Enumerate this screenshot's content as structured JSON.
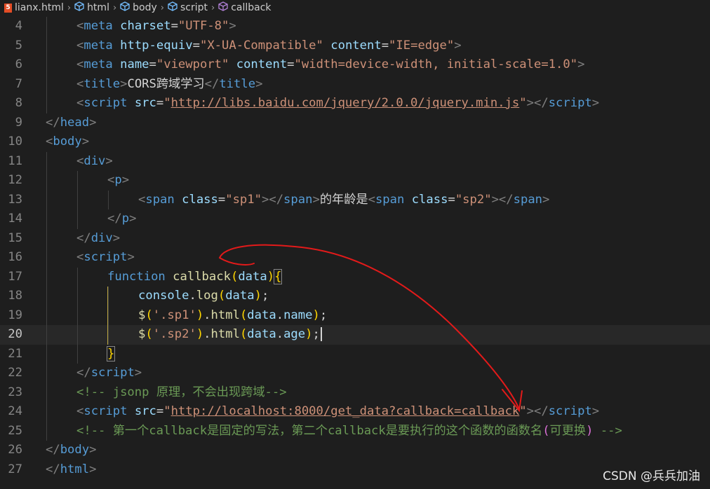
{
  "breadcrumb": [
    {
      "label": "lianx.html",
      "icon": "html-file-icon"
    },
    {
      "label": "html",
      "icon": "element-cube-icon"
    },
    {
      "label": "body",
      "icon": "element-cube-icon"
    },
    {
      "label": "script",
      "icon": "element-cube-icon"
    },
    {
      "label": "callback",
      "icon": "function-cube-icon"
    }
  ],
  "lines": [
    {
      "n": "4",
      "indent": 1,
      "tokens": [
        [
          "t",
          "<"
        ],
        [
          "tag",
          "meta"
        ],
        [
          "txt",
          " "
        ],
        [
          "attr",
          "charset"
        ],
        [
          "txt",
          "="
        ],
        [
          "str",
          "\"UTF-8\""
        ],
        [
          "t",
          ">"
        ]
      ]
    },
    {
      "n": "5",
      "indent": 1,
      "tokens": [
        [
          "t",
          "<"
        ],
        [
          "tag",
          "meta"
        ],
        [
          "txt",
          " "
        ],
        [
          "attr",
          "http-equiv"
        ],
        [
          "txt",
          "="
        ],
        [
          "str",
          "\"X-UA-Compatible\""
        ],
        [
          "txt",
          " "
        ],
        [
          "attr",
          "content"
        ],
        [
          "txt",
          "="
        ],
        [
          "str",
          "\"IE=edge\""
        ],
        [
          "t",
          ">"
        ]
      ]
    },
    {
      "n": "6",
      "indent": 1,
      "tokens": [
        [
          "t",
          "<"
        ],
        [
          "tag",
          "meta"
        ],
        [
          "txt",
          " "
        ],
        [
          "attr",
          "name"
        ],
        [
          "txt",
          "="
        ],
        [
          "str",
          "\"viewport\""
        ],
        [
          "txt",
          " "
        ],
        [
          "attr",
          "content"
        ],
        [
          "txt",
          "="
        ],
        [
          "str",
          "\"width=device-width, initial-scale=1.0\""
        ],
        [
          "t",
          ">"
        ]
      ]
    },
    {
      "n": "7",
      "indent": 1,
      "tokens": [
        [
          "t",
          "<"
        ],
        [
          "tag",
          "title"
        ],
        [
          "t",
          ">"
        ],
        [
          "txt",
          "CORS跨域学习"
        ],
        [
          "t",
          "</"
        ],
        [
          "tag",
          "title"
        ],
        [
          "t",
          ">"
        ]
      ]
    },
    {
      "n": "8",
      "indent": 1,
      "tokens": [
        [
          "t",
          "<"
        ],
        [
          "tag",
          "script"
        ],
        [
          "txt",
          " "
        ],
        [
          "attr",
          "src"
        ],
        [
          "txt",
          "="
        ],
        [
          "str",
          "\""
        ],
        [
          "str url",
          "http://libs.baidu.com/jquery/2.0.0/jquery.min.js"
        ],
        [
          "str",
          "\""
        ],
        [
          "t",
          ">"
        ],
        [
          "t",
          "</"
        ],
        [
          "tag",
          "script"
        ],
        [
          "t",
          ">"
        ]
      ]
    },
    {
      "n": "9",
      "indent": 0,
      "tokens": [
        [
          "t",
          "</"
        ],
        [
          "tag",
          "head"
        ],
        [
          "t",
          ">"
        ]
      ]
    },
    {
      "n": "10",
      "indent": 0,
      "tokens": [
        [
          "t",
          "<"
        ],
        [
          "tag",
          "body"
        ],
        [
          "t",
          ">"
        ]
      ]
    },
    {
      "n": "11",
      "indent": 1,
      "tokens": [
        [
          "t",
          "<"
        ],
        [
          "tag",
          "div"
        ],
        [
          "t",
          ">"
        ]
      ]
    },
    {
      "n": "12",
      "indent": 2,
      "tokens": [
        [
          "t",
          "<"
        ],
        [
          "tag",
          "p"
        ],
        [
          "t",
          ">"
        ]
      ]
    },
    {
      "n": "13",
      "indent": 3,
      "tokens": [
        [
          "t",
          "<"
        ],
        [
          "tag",
          "span"
        ],
        [
          "txt",
          " "
        ],
        [
          "attr",
          "class"
        ],
        [
          "txt",
          "="
        ],
        [
          "str",
          "\"sp1\""
        ],
        [
          "t",
          ">"
        ],
        [
          "t",
          "</"
        ],
        [
          "tag",
          "span"
        ],
        [
          "t",
          ">"
        ],
        [
          "txt",
          "的年龄是"
        ],
        [
          "t",
          "<"
        ],
        [
          "tag",
          "span"
        ],
        [
          "txt",
          " "
        ],
        [
          "attr",
          "class"
        ],
        [
          "txt",
          "="
        ],
        [
          "str",
          "\"sp2\""
        ],
        [
          "t",
          ">"
        ],
        [
          "t",
          "</"
        ],
        [
          "tag",
          "span"
        ],
        [
          "t",
          ">"
        ]
      ]
    },
    {
      "n": "14",
      "indent": 2,
      "tokens": [
        [
          "t",
          "</"
        ],
        [
          "tag",
          "p"
        ],
        [
          "t",
          ">"
        ]
      ]
    },
    {
      "n": "15",
      "indent": 1,
      "tokens": [
        [
          "t",
          "</"
        ],
        [
          "tag",
          "div"
        ],
        [
          "t",
          ">"
        ]
      ]
    },
    {
      "n": "16",
      "indent": 1,
      "tokens": [
        [
          "t",
          "<"
        ],
        [
          "tag",
          "script"
        ],
        [
          "t",
          ">"
        ]
      ]
    },
    {
      "n": "17",
      "indent": 2,
      "tokens": [
        [
          "kw",
          "function"
        ],
        [
          "txt",
          " "
        ],
        [
          "fn",
          "callback"
        ],
        [
          "br1",
          "("
        ],
        [
          "var",
          "data"
        ],
        [
          "br1",
          ")"
        ],
        [
          "br1 brace-match",
          "{"
        ]
      ]
    },
    {
      "n": "18",
      "indent": 3,
      "tokens": [
        [
          "var",
          "console"
        ],
        [
          "txt",
          "."
        ],
        [
          "fn",
          "log"
        ],
        [
          "br1",
          "("
        ],
        [
          "var",
          "data"
        ],
        [
          "br1",
          ")"
        ],
        [
          "txt",
          ";"
        ]
      ]
    },
    {
      "n": "19",
      "indent": 3,
      "tokens": [
        [
          "fn",
          "$"
        ],
        [
          "br1",
          "("
        ],
        [
          "str",
          "'.sp1'"
        ],
        [
          "br1",
          ")"
        ],
        [
          "txt",
          "."
        ],
        [
          "fn",
          "html"
        ],
        [
          "br1",
          "("
        ],
        [
          "var",
          "data"
        ],
        [
          "txt",
          "."
        ],
        [
          "var",
          "name"
        ],
        [
          "br1",
          ")"
        ],
        [
          "txt",
          ";"
        ]
      ]
    },
    {
      "n": "20",
      "indent": 3,
      "current": true,
      "tokens": [
        [
          "fn",
          "$"
        ],
        [
          "br1",
          "("
        ],
        [
          "str",
          "'.sp2'"
        ],
        [
          "br1",
          ")"
        ],
        [
          "txt",
          "."
        ],
        [
          "fn",
          "html"
        ],
        [
          "br1",
          "("
        ],
        [
          "var",
          "data"
        ],
        [
          "txt",
          "."
        ],
        [
          "var",
          "age"
        ],
        [
          "br1",
          ")"
        ],
        [
          "txt",
          ";"
        ],
        [
          "cursor",
          ""
        ]
      ]
    },
    {
      "n": "21",
      "indent": 2,
      "tokens": [
        [
          "br1 brace-match",
          "}"
        ]
      ]
    },
    {
      "n": "22",
      "indent": 1,
      "tokens": [
        [
          "t",
          "</"
        ],
        [
          "tag",
          "script"
        ],
        [
          "t",
          ">"
        ]
      ]
    },
    {
      "n": "23",
      "indent": 1,
      "tokens": [
        [
          "cm",
          "<!-- jsonp 原理，不会出现跨域-->"
        ]
      ]
    },
    {
      "n": "24",
      "indent": 1,
      "tokens": [
        [
          "t",
          "<"
        ],
        [
          "tag",
          "script"
        ],
        [
          "txt",
          " "
        ],
        [
          "attr",
          "src"
        ],
        [
          "txt",
          "="
        ],
        [
          "str",
          "\""
        ],
        [
          "str url",
          "http://localhost:8000/get_data?callback=callback"
        ],
        [
          "str",
          "\""
        ],
        [
          "t",
          ">"
        ],
        [
          "t",
          "</"
        ],
        [
          "tag",
          "script"
        ],
        [
          "t",
          ">"
        ]
      ]
    },
    {
      "n": "25",
      "indent": 1,
      "tokens": [
        [
          "cm",
          "<!-- 第一个callback是固定的写法，第二个callback是要执行的这个函数的函数名"
        ],
        [
          "br2",
          "("
        ],
        [
          "cm",
          "可更换"
        ],
        [
          "br2",
          ")"
        ],
        [
          "cm",
          " -->"
        ]
      ]
    },
    {
      "n": "26",
      "indent": 0,
      "tokens": [
        [
          "t",
          "</"
        ],
        [
          "tag",
          "body"
        ],
        [
          "t",
          ">"
        ]
      ]
    },
    {
      "n": "27",
      "indent": 0,
      "tokens": [
        [
          "t",
          "</"
        ],
        [
          "tag",
          "html"
        ],
        [
          "t",
          ">"
        ]
      ]
    }
  ],
  "watermark": "CSDN @兵兵加油",
  "annotation_color": "#e31a1a"
}
